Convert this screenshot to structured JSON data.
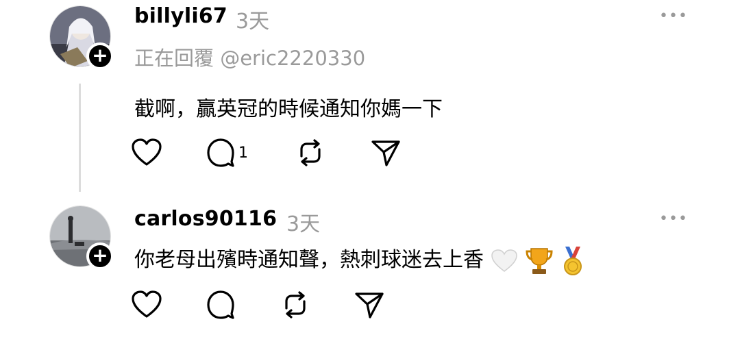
{
  "posts": [
    {
      "username": "billyli67",
      "time": "3天",
      "more_label": "•••",
      "reply_to": "正在回覆 @eric2220330",
      "text": "截啊，贏英冠的時候通知你媽一下",
      "reply_count": "1",
      "follow_label": "+"
    },
    {
      "username": "carlos90116",
      "time": "3天",
      "more_label": "•••",
      "text": "你老母出殯時通知聲，熱刺球迷去上香",
      "emojis": [
        "white-heart",
        "trophy",
        "medal"
      ],
      "follow_label": "+"
    }
  ],
  "icons": {
    "actions": [
      "heart-icon",
      "comment-icon",
      "repost-icon",
      "share-icon"
    ]
  },
  "colors": {
    "muted": "#9a9a9a",
    "line": "#dcdcdc",
    "text": "#000000"
  }
}
